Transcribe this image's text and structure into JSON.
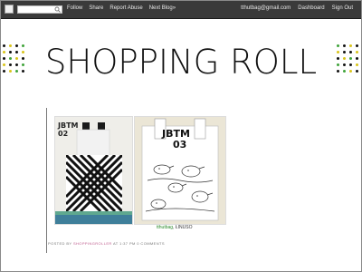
{
  "navbar": {
    "search_placeholder": "",
    "left_links": [
      "Follow",
      "Share",
      "Report Abuse",
      "Next Blog»"
    ],
    "user_email": "tthutbag@gmail.com",
    "right_links": [
      "Dashboard",
      "Sign Out"
    ]
  },
  "header": {
    "title": "SHOPPING ROLL",
    "dot_colors": [
      "#111111",
      "#d9c51a",
      "#3fa33a"
    ]
  },
  "post": {
    "images": [
      {
        "label": "bag-with-stripes-photo",
        "tag_text": "JBTM 02"
      },
      {
        "label": "bag-with-birds-photo",
        "tag_text": "JBTM 03"
      }
    ],
    "caption_link": "tthutbag",
    "caption_text": ", ŁINUSO",
    "footer_prefix": "POSTED BY",
    "footer_author": "SHOPPINGROLLER",
    "footer_at": "AT",
    "footer_time": "1:37 PM",
    "footer_comments": "0 COMMENTS"
  }
}
